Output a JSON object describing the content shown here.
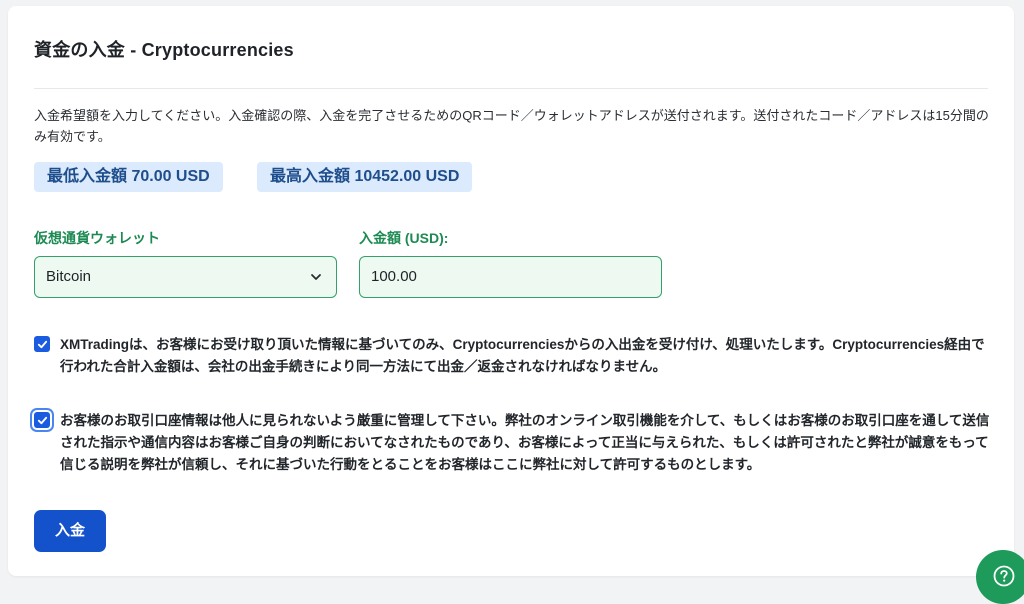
{
  "header": {
    "title": "資金の入金 - Cryptocurrencies"
  },
  "description": "入金希望額を入力してください。入金確認の際、入金を完了させるためのQRコード／ウォレットアドレスが送付されます。送付されたコード／アドレスは15分間のみ有効です。",
  "limits": {
    "min_label": "最低入金額 70.00 USD",
    "max_label": "最高入金額 10452.00 USD"
  },
  "form": {
    "wallet_label": "仮想通貨ウォレット",
    "wallet_value": "Bitcoin",
    "amount_label": "入金額 (USD):",
    "amount_value": "100.00"
  },
  "consents": [
    {
      "checked": true,
      "text": "XMTradingは、お客様にお受け取り頂いた情報に基づいてのみ、Cryptocurrenciesからの入出金を受け付け、処理いたします。Cryptocurrencies経由で行われた合計入金額は、会社の出金手続きにより同一方法にて出金／返金されなければなりません。"
    },
    {
      "checked": true,
      "text": "お客様のお取引口座情報は他人に見られないよう厳重に管理して下さい。弊社のオンライン取引機能を介して、もしくはお客様のお取引口座を通して送信された指示や通信内容はお客様ご自身の判断においてなされたものであり、お客様によって正当に与えられた、もしくは許可されたと弊社が誠意をもって信じる説明を弊社が信頼し、それに基づいた行動をとることをお客様はここに弊社に対して許可するものとします。"
    }
  ],
  "actions": {
    "submit_label": "入金"
  },
  "icons": {
    "select_chevron": "chevron-down-icon",
    "checkbox": "check-icon",
    "help": "help-question-icon"
  },
  "colors": {
    "accent_blue": "#1452cc",
    "label_green": "#1e8a53",
    "field_border": "#34a06a",
    "badge_bg": "#dbeafc",
    "help_bg": "#1e9a5a"
  }
}
